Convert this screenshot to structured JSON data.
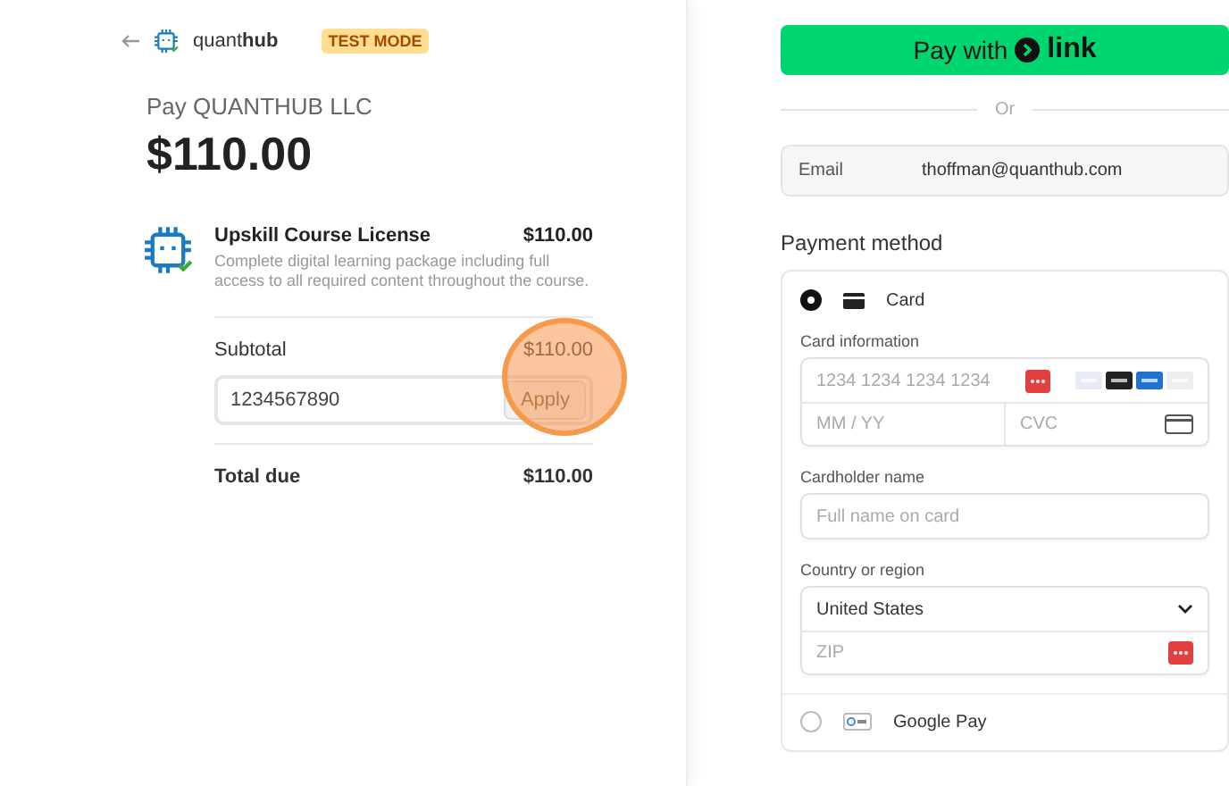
{
  "header": {
    "logo": "quant**hub**",
    "badge": "TEST MODE"
  },
  "summary": {
    "title": "Pay QUANTHUB LLC",
    "amount": "$110.00"
  },
  "item": {
    "name": "Upskill Course License",
    "price": "$110.00",
    "description": "Complete digital learning package including full access to all required content throughout the course."
  },
  "subtotal": {
    "label": "Subtotal",
    "value": "$110.00"
  },
  "promo": {
    "value": "1234567890",
    "button": "Apply",
    "highlighted": true
  },
  "total": {
    "label": "Total due",
    "value": "$110.00"
  },
  "link_button": {
    "label": "Pay with",
    "brand": "link"
  },
  "divider_text": "Or",
  "email": {
    "label": "Email",
    "value": "thoffman@quanthub.com"
  },
  "payment_method": {
    "title": "Payment method",
    "options": [
      {
        "kind": "card",
        "label": "Card",
        "selected": true
      },
      {
        "kind": "gpay",
        "label": "Google Pay",
        "selected": false
      }
    ],
    "card_info": {
      "label": "Card information",
      "number_placeholder": "1234 1234 1234 1234",
      "expiry_placeholder": "MM / YY",
      "cvc_placeholder": "CVC"
    },
    "cardholder": {
      "label": "Cardholder name",
      "placeholder": "Full name on card"
    },
    "country": {
      "label": "Country or region",
      "value": "United States",
      "zip_placeholder": "ZIP"
    }
  }
}
